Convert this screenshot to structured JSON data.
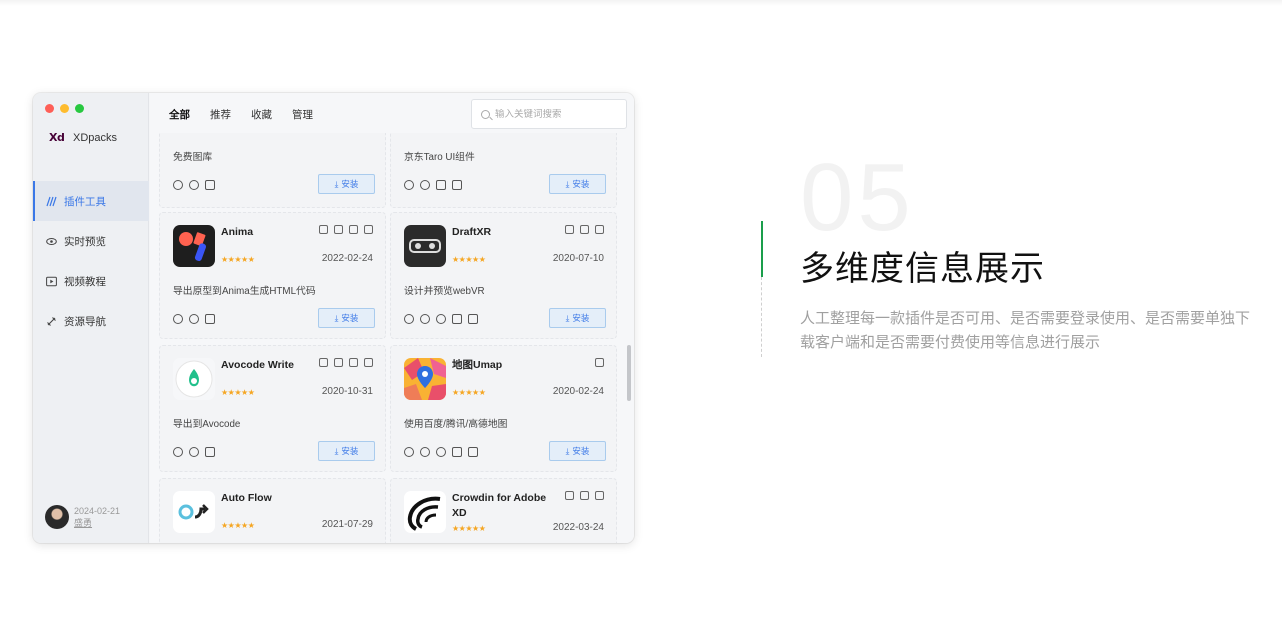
{
  "app": {
    "name": "XDpacks",
    "logo_text": "Xd"
  },
  "sidebar": {
    "items": [
      {
        "label": "插件工具",
        "icon": "plugin-icon",
        "active": true
      },
      {
        "label": "实时预览",
        "icon": "eye-icon",
        "active": false
      },
      {
        "label": "视频教程",
        "icon": "video-icon",
        "active": false
      },
      {
        "label": "资源导航",
        "icon": "link-icon",
        "active": false
      }
    ],
    "user": {
      "date": "2024-02-21",
      "name": "盛勇"
    }
  },
  "tabs": [
    {
      "label": "全部",
      "active": true
    },
    {
      "label": "推荐",
      "active": false
    },
    {
      "label": "收藏",
      "active": false
    },
    {
      "label": "管理",
      "active": false
    }
  ],
  "search": {
    "placeholder": "输入关键词搜索"
  },
  "install_label": "安装",
  "install_icon": "download-icon",
  "star_text": "★★★★★",
  "cards": [
    {
      "name": "",
      "date": "",
      "desc": "免费图库",
      "partial": true
    },
    {
      "name": "",
      "date": "",
      "desc": "京东Taro UI组件",
      "partial": true
    },
    {
      "name": "Anima",
      "date": "2022-02-24",
      "desc": "导出原型到Anima生成HTML代码",
      "rating": 5
    },
    {
      "name": "DraftXR",
      "date": "2020-07-10",
      "desc": "设计并预览webVR",
      "rating": 5
    },
    {
      "name": "Avocode Write",
      "date": "2020-10-31",
      "desc": "导出到Avocode",
      "rating": 5
    },
    {
      "name": "地图Umap",
      "date": "2020-02-24",
      "desc": "使用百度/腾讯/高德地图",
      "rating": 5
    },
    {
      "name": "Auto Flow",
      "date": "2021-07-29",
      "desc": "",
      "rating": 5
    },
    {
      "name": "Crowdin for Adobe XD",
      "date": "2022-03-24",
      "desc": "",
      "rating": 5
    }
  ],
  "feature": {
    "number": "05",
    "title": "多维度信息展示",
    "description": "人工整理每一款插件是否可用、是否需要登录使用、是否需要单独下载客户端和是否需要付费使用等信息进行展示",
    "accent_color": "#1a9e4b"
  }
}
